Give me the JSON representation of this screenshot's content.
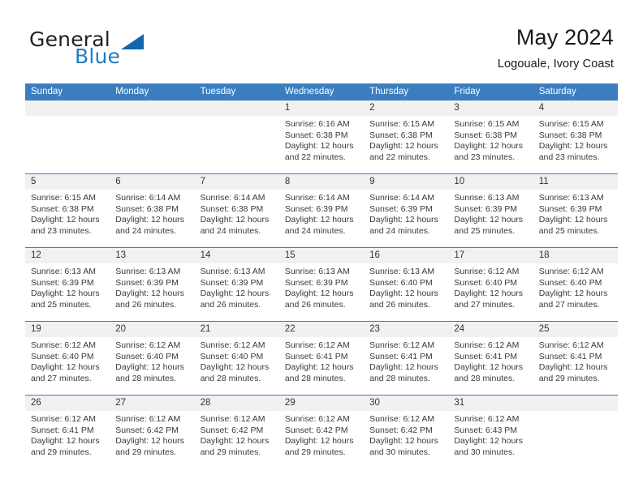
{
  "brand": {
    "name_part1": "General",
    "name_part2": "Blue",
    "triangle_icon": "triangle-icon",
    "accent_color": "#1f7dc4"
  },
  "header": {
    "title": "May 2024",
    "subtitle": "Logouale, Ivory Coast"
  },
  "colors": {
    "header_row_bg": "#3a7ebf",
    "daynum_band_bg": "#f1f1f1",
    "row_divider": "#3a7ebf",
    "text": "#3a3a3a"
  },
  "calendar": {
    "weekdays": [
      "Sunday",
      "Monday",
      "Tuesday",
      "Wednesday",
      "Thursday",
      "Friday",
      "Saturday"
    ],
    "weeks": [
      {
        "days": [
          {
            "num": "",
            "lines": [
              "",
              "",
              "",
              ""
            ]
          },
          {
            "num": "",
            "lines": [
              "",
              "",
              "",
              ""
            ]
          },
          {
            "num": "",
            "lines": [
              "",
              "",
              "",
              ""
            ]
          },
          {
            "num": "1",
            "lines": [
              "Sunrise: 6:16 AM",
              "Sunset: 6:38 PM",
              "Daylight: 12 hours",
              "and 22 minutes."
            ]
          },
          {
            "num": "2",
            "lines": [
              "Sunrise: 6:15 AM",
              "Sunset: 6:38 PM",
              "Daylight: 12 hours",
              "and 22 minutes."
            ]
          },
          {
            "num": "3",
            "lines": [
              "Sunrise: 6:15 AM",
              "Sunset: 6:38 PM",
              "Daylight: 12 hours",
              "and 23 minutes."
            ]
          },
          {
            "num": "4",
            "lines": [
              "Sunrise: 6:15 AM",
              "Sunset: 6:38 PM",
              "Daylight: 12 hours",
              "and 23 minutes."
            ]
          }
        ]
      },
      {
        "days": [
          {
            "num": "5",
            "lines": [
              "Sunrise: 6:15 AM",
              "Sunset: 6:38 PM",
              "Daylight: 12 hours",
              "and 23 minutes."
            ]
          },
          {
            "num": "6",
            "lines": [
              "Sunrise: 6:14 AM",
              "Sunset: 6:38 PM",
              "Daylight: 12 hours",
              "and 24 minutes."
            ]
          },
          {
            "num": "7",
            "lines": [
              "Sunrise: 6:14 AM",
              "Sunset: 6:38 PM",
              "Daylight: 12 hours",
              "and 24 minutes."
            ]
          },
          {
            "num": "8",
            "lines": [
              "Sunrise: 6:14 AM",
              "Sunset: 6:39 PM",
              "Daylight: 12 hours",
              "and 24 minutes."
            ]
          },
          {
            "num": "9",
            "lines": [
              "Sunrise: 6:14 AM",
              "Sunset: 6:39 PM",
              "Daylight: 12 hours",
              "and 24 minutes."
            ]
          },
          {
            "num": "10",
            "lines": [
              "Sunrise: 6:13 AM",
              "Sunset: 6:39 PM",
              "Daylight: 12 hours",
              "and 25 minutes."
            ]
          },
          {
            "num": "11",
            "lines": [
              "Sunrise: 6:13 AM",
              "Sunset: 6:39 PM",
              "Daylight: 12 hours",
              "and 25 minutes."
            ]
          }
        ]
      },
      {
        "days": [
          {
            "num": "12",
            "lines": [
              "Sunrise: 6:13 AM",
              "Sunset: 6:39 PM",
              "Daylight: 12 hours",
              "and 25 minutes."
            ]
          },
          {
            "num": "13",
            "lines": [
              "Sunrise: 6:13 AM",
              "Sunset: 6:39 PM",
              "Daylight: 12 hours",
              "and 26 minutes."
            ]
          },
          {
            "num": "14",
            "lines": [
              "Sunrise: 6:13 AM",
              "Sunset: 6:39 PM",
              "Daylight: 12 hours",
              "and 26 minutes."
            ]
          },
          {
            "num": "15",
            "lines": [
              "Sunrise: 6:13 AM",
              "Sunset: 6:39 PM",
              "Daylight: 12 hours",
              "and 26 minutes."
            ]
          },
          {
            "num": "16",
            "lines": [
              "Sunrise: 6:13 AM",
              "Sunset: 6:40 PM",
              "Daylight: 12 hours",
              "and 26 minutes."
            ]
          },
          {
            "num": "17",
            "lines": [
              "Sunrise: 6:12 AM",
              "Sunset: 6:40 PM",
              "Daylight: 12 hours",
              "and 27 minutes."
            ]
          },
          {
            "num": "18",
            "lines": [
              "Sunrise: 6:12 AM",
              "Sunset: 6:40 PM",
              "Daylight: 12 hours",
              "and 27 minutes."
            ]
          }
        ]
      },
      {
        "days": [
          {
            "num": "19",
            "lines": [
              "Sunrise: 6:12 AM",
              "Sunset: 6:40 PM",
              "Daylight: 12 hours",
              "and 27 minutes."
            ]
          },
          {
            "num": "20",
            "lines": [
              "Sunrise: 6:12 AM",
              "Sunset: 6:40 PM",
              "Daylight: 12 hours",
              "and 28 minutes."
            ]
          },
          {
            "num": "21",
            "lines": [
              "Sunrise: 6:12 AM",
              "Sunset: 6:40 PM",
              "Daylight: 12 hours",
              "and 28 minutes."
            ]
          },
          {
            "num": "22",
            "lines": [
              "Sunrise: 6:12 AM",
              "Sunset: 6:41 PM",
              "Daylight: 12 hours",
              "and 28 minutes."
            ]
          },
          {
            "num": "23",
            "lines": [
              "Sunrise: 6:12 AM",
              "Sunset: 6:41 PM",
              "Daylight: 12 hours",
              "and 28 minutes."
            ]
          },
          {
            "num": "24",
            "lines": [
              "Sunrise: 6:12 AM",
              "Sunset: 6:41 PM",
              "Daylight: 12 hours",
              "and 28 minutes."
            ]
          },
          {
            "num": "25",
            "lines": [
              "Sunrise: 6:12 AM",
              "Sunset: 6:41 PM",
              "Daylight: 12 hours",
              "and 29 minutes."
            ]
          }
        ]
      },
      {
        "days": [
          {
            "num": "26",
            "lines": [
              "Sunrise: 6:12 AM",
              "Sunset: 6:41 PM",
              "Daylight: 12 hours",
              "and 29 minutes."
            ]
          },
          {
            "num": "27",
            "lines": [
              "Sunrise: 6:12 AM",
              "Sunset: 6:42 PM",
              "Daylight: 12 hours",
              "and 29 minutes."
            ]
          },
          {
            "num": "28",
            "lines": [
              "Sunrise: 6:12 AM",
              "Sunset: 6:42 PM",
              "Daylight: 12 hours",
              "and 29 minutes."
            ]
          },
          {
            "num": "29",
            "lines": [
              "Sunrise: 6:12 AM",
              "Sunset: 6:42 PM",
              "Daylight: 12 hours",
              "and 29 minutes."
            ]
          },
          {
            "num": "30",
            "lines": [
              "Sunrise: 6:12 AM",
              "Sunset: 6:42 PM",
              "Daylight: 12 hours",
              "and 30 minutes."
            ]
          },
          {
            "num": "31",
            "lines": [
              "Sunrise: 6:12 AM",
              "Sunset: 6:43 PM",
              "Daylight: 12 hours",
              "and 30 minutes."
            ]
          },
          {
            "num": "",
            "lines": [
              "",
              "",
              "",
              ""
            ]
          }
        ]
      }
    ]
  }
}
